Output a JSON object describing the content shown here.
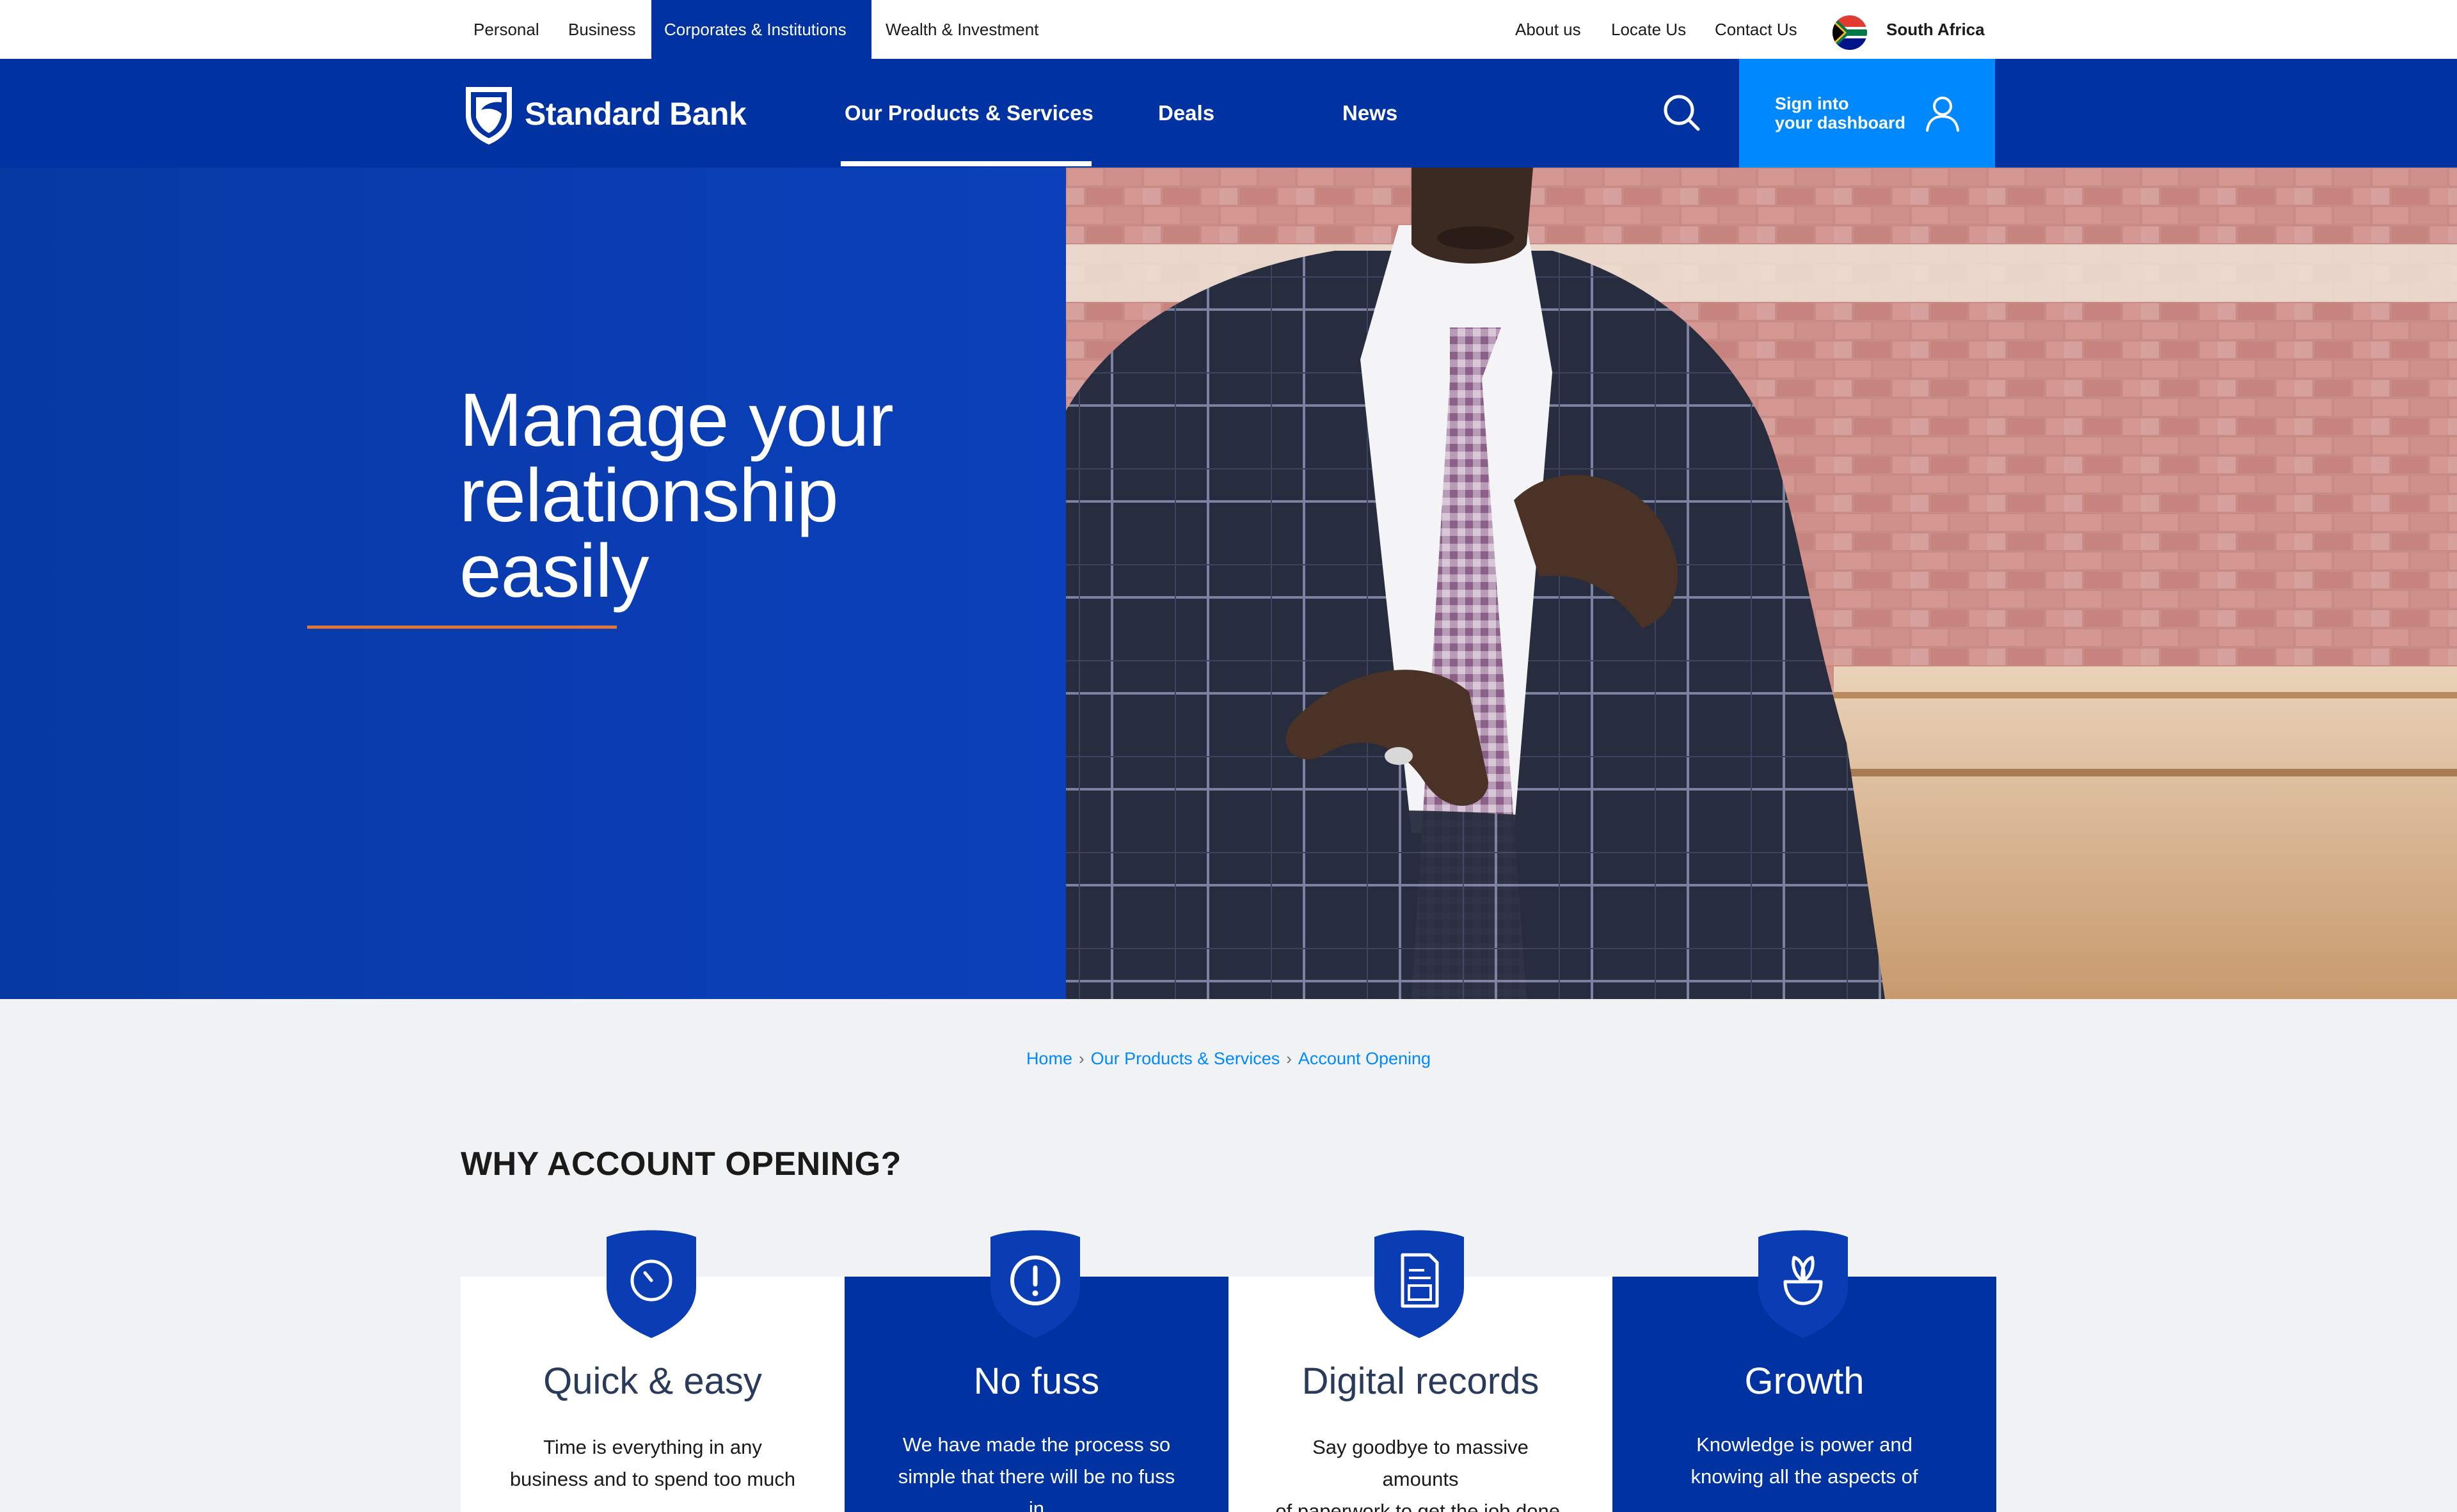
{
  "top_bar": {
    "segments": [
      "Personal",
      "Business",
      "Corporates & Institutions",
      "Wealth & Investment"
    ],
    "links": [
      "About us",
      "Locate Us",
      "Contact Us"
    ],
    "country": "South Africa"
  },
  "main_nav": {
    "brand": "Standard Bank",
    "links": [
      "Our Products & Services",
      "Deals",
      "News"
    ],
    "active": "Our Products & Services",
    "sign_in_line1": "Sign into",
    "sign_in_line2": "your dashboard"
  },
  "hero": {
    "title_line1": "Manage your",
    "title_line2": "relationship",
    "title_line3": "easily"
  },
  "breadcrumb": [
    "Home",
    "Our Products & Services",
    "Account Opening"
  ],
  "section_title": "WHY ACCOUNT OPENING?",
  "cards": [
    {
      "title": "Quick & easy",
      "lines": [
        "Time is everything in any",
        "business and to spend too much"
      ],
      "icon": "clock-icon"
    },
    {
      "title": "No fuss",
      "lines": [
        "We have made the process so",
        "simple that there will be no fuss in"
      ],
      "icon": "alert-icon"
    },
    {
      "title": "Digital records",
      "lines": [
        "Say goodbye to massive amounts",
        "of paperwork to get the job done."
      ],
      "icon": "document-icon"
    },
    {
      "title": "Growth",
      "lines": [
        "Knowledge is power and",
        "knowing all the  aspects  of"
      ],
      "icon": "plant-icon"
    }
  ],
  "colors": {
    "brand_blue": "#0033a1",
    "sign_in_blue": "#0089ff",
    "accent_orange": "#e0753a",
    "page_background": "#f1f2f4"
  }
}
